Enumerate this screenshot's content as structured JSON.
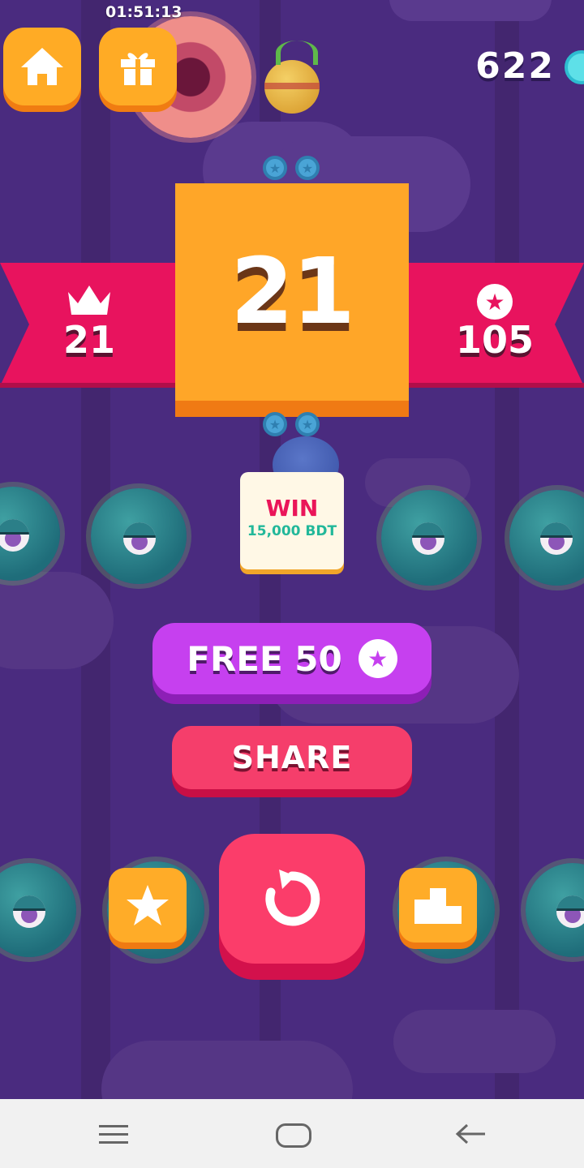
{
  "status_bar": {
    "time": "01:51:13"
  },
  "header": {
    "home_icon": "home-icon",
    "gift_icon": "gift-icon",
    "coins": "622",
    "coin_icon": "cyan-gem-icon"
  },
  "score": {
    "current": "21",
    "best": "21",
    "best_icon": "crown-icon",
    "stars": "105",
    "stars_icon": "star-icon"
  },
  "promo": {
    "title": "WIN",
    "prize": "15,000 BDT"
  },
  "buttons": {
    "free_label": "FREE 50",
    "free_icon": "star-icon",
    "share_label": "SHARE",
    "replay_icon": "replay-icon",
    "rate_icon": "star-icon",
    "leaderboard_icon": "podium-icon"
  },
  "colors": {
    "background": "#4a2b7f",
    "ribbon": "#e8135e",
    "score_box": "#ffa628",
    "free_button": "#c640ef",
    "share_button": "#f53e6b",
    "replay_button": "#fb3d6a",
    "promo_text": "#ea1559",
    "promo_subtext": "#22b89a"
  },
  "nav": {
    "menu_icon": "menu-icon",
    "home_icon": "home-pill-icon",
    "back_icon": "back-arrow-icon"
  }
}
